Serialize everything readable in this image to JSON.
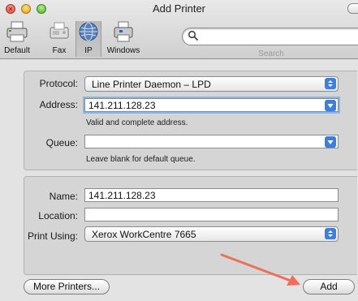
{
  "window": {
    "title": "Add Printer"
  },
  "toolbar": {
    "items": [
      {
        "label": "Default",
        "icon": "printer-icon"
      },
      {
        "label": "Fax",
        "icon": "fax-icon"
      },
      {
        "label": "IP",
        "icon": "globe-icon",
        "selected": true
      },
      {
        "label": "Windows",
        "icon": "windows-printer-icon"
      }
    ],
    "search_caption": "Search"
  },
  "connection": {
    "protocol_label": "Protocol:",
    "protocol_value": "Line Printer Daemon – LPD",
    "address_label": "Address:",
    "address_value": "141.211.128.23",
    "address_help": "Valid and complete address.",
    "queue_label": "Queue:",
    "queue_value": "",
    "queue_help": "Leave blank for default queue."
  },
  "details": {
    "name_label": "Name:",
    "name_value": "141.211.128.23",
    "location_label": "Location:",
    "location_value": "",
    "print_using_label": "Print Using:",
    "print_using_value": "Xerox WorkCentre 7665"
  },
  "buttons": {
    "more_printers": "More Printers...",
    "add": "Add"
  },
  "colors": {
    "annotation_arrow": "#ef6f5a",
    "popup_arrows": "#3d7fdc"
  }
}
